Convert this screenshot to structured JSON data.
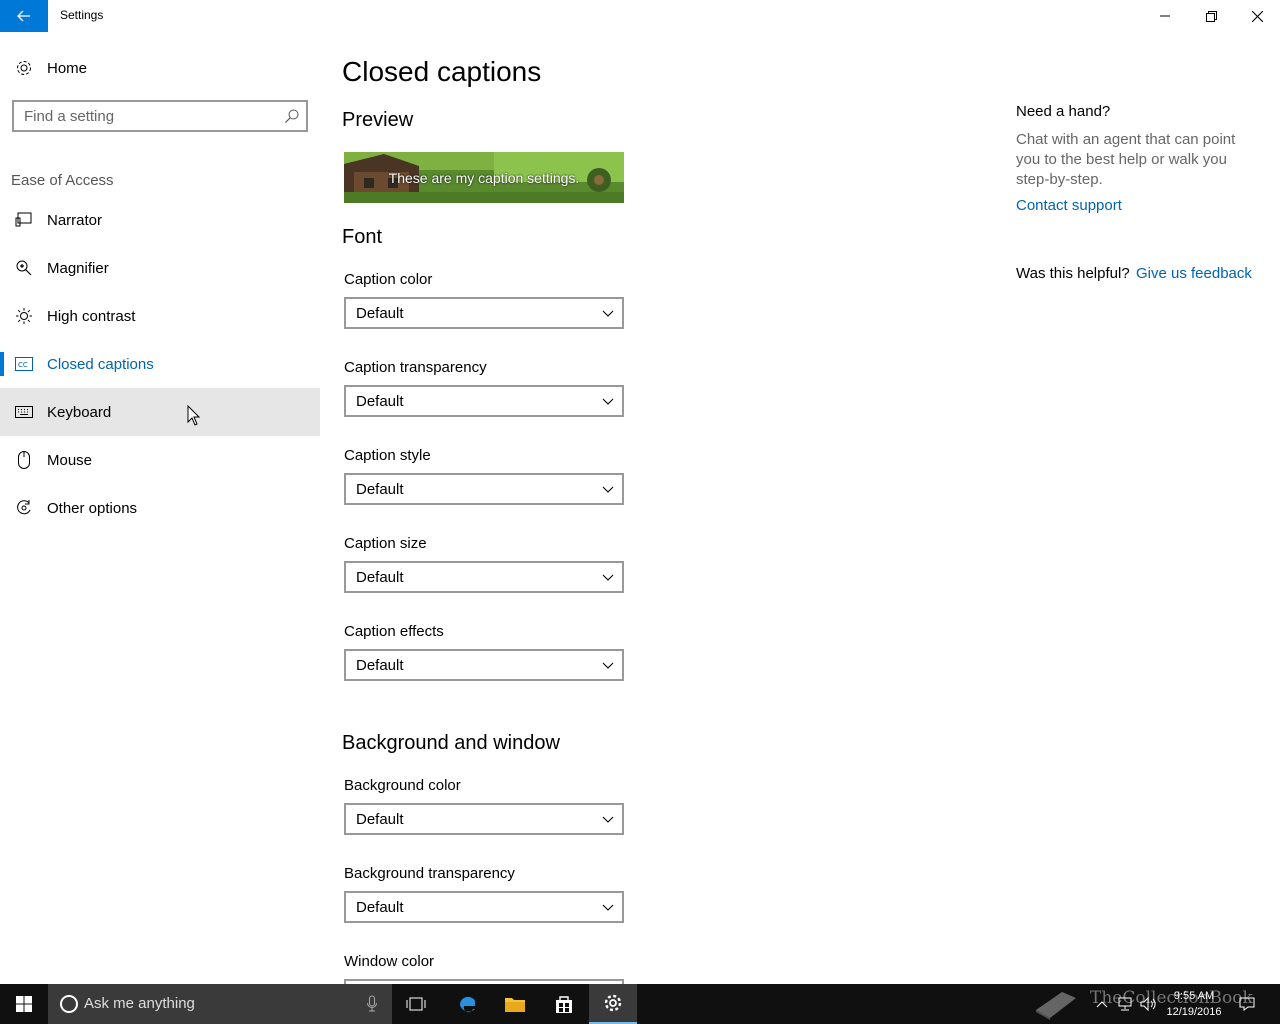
{
  "window": {
    "title": "Settings",
    "back_icon": "arrow-left-icon",
    "minimize_icon": "minimize-icon",
    "maximize_icon": "restore-icon",
    "close_icon": "close-icon"
  },
  "sidebar": {
    "home_label": "Home",
    "search_placeholder": "Find a setting",
    "section_label": "Ease of Access",
    "items": [
      {
        "label": "Narrator",
        "icon": "narrator-icon"
      },
      {
        "label": "Magnifier",
        "icon": "magnifier-icon"
      },
      {
        "label": "High contrast",
        "icon": "high-contrast-icon"
      },
      {
        "label": "Closed captions",
        "icon": "closed-captions-icon",
        "active": true
      },
      {
        "label": "Keyboard",
        "icon": "keyboard-icon",
        "hover": true
      },
      {
        "label": "Mouse",
        "icon": "mouse-icon"
      },
      {
        "label": "Other options",
        "icon": "other-options-icon"
      }
    ]
  },
  "main": {
    "title": "Closed captions",
    "preview_heading": "Preview",
    "preview_text": "These are my caption settings.",
    "font_heading": "Font",
    "font_fields": [
      {
        "label": "Caption color",
        "value": "Default"
      },
      {
        "label": "Caption transparency",
        "value": "Default"
      },
      {
        "label": "Caption style",
        "value": "Default"
      },
      {
        "label": "Caption size",
        "value": "Default"
      },
      {
        "label": "Caption effects",
        "value": "Default"
      }
    ],
    "background_heading": "Background and window",
    "background_fields": [
      {
        "label": "Background color",
        "value": "Default"
      },
      {
        "label": "Background transparency",
        "value": "Default"
      },
      {
        "label": "Window color",
        "value": ""
      }
    ]
  },
  "help": {
    "title": "Need a hand?",
    "body": "Chat with an agent that can point you to the best help or walk you step-by-step.",
    "link": "Contact support",
    "helpful_question": "Was this helpful?",
    "feedback_link": "Give us feedback"
  },
  "taskbar": {
    "search_placeholder": "Ask me anything",
    "time": "9:55 AM",
    "date": "12/19/2016",
    "watermark": "TheCollectionBook"
  },
  "colors": {
    "accent": "#0078d7",
    "link": "#0063b1",
    "taskbar": "#101010",
    "hover": "#e6e6e6"
  }
}
